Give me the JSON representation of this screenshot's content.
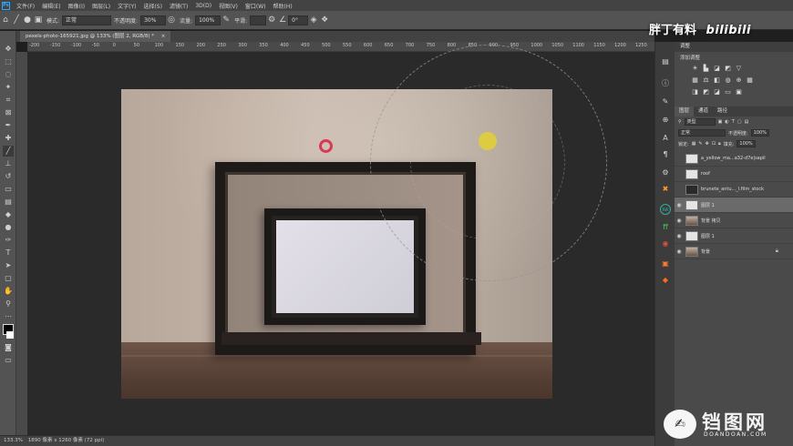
{
  "menu": {
    "app_badge": "Ps",
    "items": [
      "文件(F)",
      "编辑(E)",
      "图像(I)",
      "图层(L)",
      "文字(Y)",
      "选择(S)",
      "滤镜(T)",
      "3D(D)",
      "视图(V)",
      "窗口(W)",
      "帮助(H)"
    ]
  },
  "options": {
    "mode_label": "模式:",
    "mode_value": "正常",
    "opacity_label": "不透明度:",
    "opacity_value": "30%",
    "flow_label": "流量:",
    "flow_value": "100%",
    "smooth_label": "平滑:",
    "angle_value": "0°"
  },
  "document": {
    "tab_title": "pexels-photo-165921.jpg @ 133% (图层 2, RGB/8) *"
  },
  "ruler": {
    "h_labels": [
      "-200",
      "-150",
      "-100",
      "-50",
      "0",
      "50",
      "100",
      "150",
      "200",
      "250",
      "300",
      "350",
      "400",
      "450",
      "500",
      "550",
      "600",
      "650",
      "700",
      "750",
      "800",
      "850",
      "900",
      "950",
      "1000",
      "1050",
      "1100",
      "1150",
      "1200",
      "1250"
    ]
  },
  "status": {
    "zoom": "133.3%",
    "doc_info": "1890 像素 x 1260 像素 (72 ppi)"
  },
  "panels": {
    "adjustments_tab": "调整",
    "adjustments_title": "添加调整",
    "layers_tabs": [
      "图层",
      "通道",
      "路径"
    ],
    "kind_label": "类型",
    "blend_mode": "正常",
    "opacity_label": "不透明度:",
    "opacity_value": "100%",
    "lock_label": "锁定:",
    "fill_label": "填充:",
    "fill_value": "100%",
    "layers": [
      {
        "name": "a_yellow_ma...a32-d7e|sapil",
        "thumb": "w",
        "selected": false
      },
      {
        "name": "roof",
        "thumb": "w",
        "selected": false
      },
      {
        "name": "brunete_antu..._l.film_stock",
        "thumb": "dk",
        "selected": false
      },
      {
        "name": "图层 1",
        "thumb": "w",
        "selected": true
      },
      {
        "name": "背景 拷贝",
        "thumb": "ph",
        "selected": false
      },
      {
        "name": "图层 1",
        "thumb": "w",
        "selected": false
      },
      {
        "name": "背景",
        "thumb": "ph",
        "selected": false
      }
    ]
  },
  "watermark": {
    "top_text": "胖丁有料",
    "top_brand": "bilibili",
    "bottom_text": "铛图网",
    "bottom_sub": "DOANDOAN.COM"
  },
  "colors": {
    "ps_blue": "#31a8ff",
    "marker_red": "#d93a52",
    "marker_yellow": "#e0cd3c",
    "canvas_bg": "#2a2a2a"
  }
}
